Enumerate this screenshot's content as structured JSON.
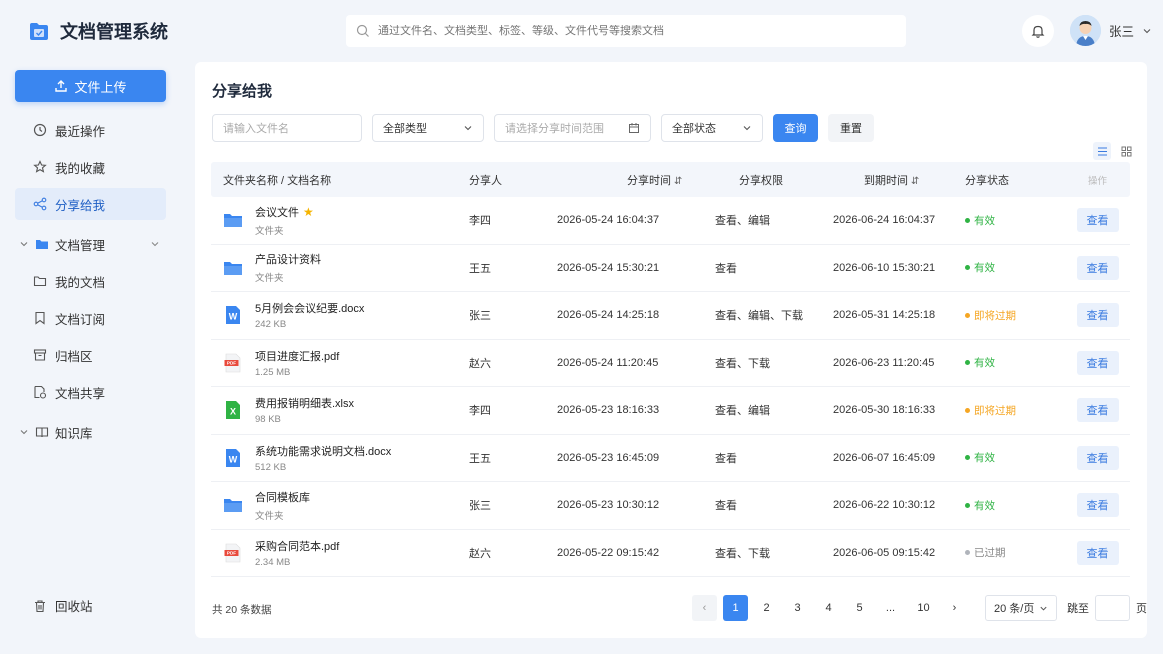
{
  "app": {
    "title": "文档管理系统"
  },
  "sidebar": {
    "upload_label": "文件上传",
    "items": [
      {
        "label": "最近操作",
        "icon": "clock-icon"
      },
      {
        "label": "我的收藏",
        "icon": "star-icon"
      },
      {
        "label": "分享给我",
        "icon": "share-icon",
        "active": true
      }
    ],
    "group_doc": {
      "label": "文档管理",
      "icon": "folder-icon"
    },
    "doc_items": [
      {
        "label": "我的文档",
        "icon": "folder-outline-icon"
      },
      {
        "label": "文档订阅",
        "icon": "bookmark-icon"
      },
      {
        "label": "归档区",
        "icon": "archive-icon"
      },
      {
        "label": "文档共享",
        "icon": "share-doc-icon"
      }
    ],
    "group_kb": {
      "label": "知识库",
      "icon": "book-icon"
    },
    "recycle_label": "回收站"
  },
  "header": {
    "search_placeholder": "通过文件名、文档类型、标签、等级、文件代号等搜索文档",
    "username": "张三"
  },
  "main": {
    "title": "分享给我",
    "filters": {
      "name_placeholder": "请输入文件名",
      "type_value": "全部类型",
      "date_placeholder": "请选择分享时间范围",
      "status_value": "全部状态",
      "query_label": "查询",
      "reset_label": "重置"
    },
    "columns": [
      "文件夹名称 / 文档名称",
      "分享人",
      "分享时间",
      "分享权限",
      "到期时间",
      "分享状态",
      "操作"
    ],
    "rows": [
      {
        "name": "会议文件",
        "meta": "文件夹",
        "type": "folder",
        "starred": true,
        "sharer": "李四",
        "share_time": "2026-05-24 16:04:37",
        "permission": "查看、编辑",
        "expire": "2026-06-24 16:04:37",
        "status": "有效",
        "status_kind": "valid",
        "action": "查看"
      },
      {
        "name": "产品设计资料",
        "meta": "文件夹",
        "type": "folder",
        "starred": false,
        "sharer": "王五",
        "share_time": "2026-05-24 15:30:21",
        "permission": "查看",
        "expire": "2026-06-10 15:30:21",
        "status": "有效",
        "status_kind": "valid",
        "action": "查看"
      },
      {
        "name": "5月例会会议纪要.docx",
        "meta": "242 KB",
        "type": "word",
        "starred": false,
        "sharer": "张三",
        "share_time": "2026-05-24 14:25:18",
        "permission": "查看、编辑、下载",
        "expire": "2026-05-31 14:25:18",
        "status": "即将过期",
        "status_kind": "expiring",
        "action": "查看"
      },
      {
        "name": "项目进度汇报.pdf",
        "meta": "1.25 MB",
        "type": "pdf",
        "starred": false,
        "sharer": "赵六",
        "share_time": "2026-05-24 11:20:45",
        "permission": "查看、下载",
        "expire": "2026-06-23 11:20:45",
        "status": "有效",
        "status_kind": "valid",
        "action": "查看"
      },
      {
        "name": "费用报销明细表.xlsx",
        "meta": "98 KB",
        "type": "excel",
        "starred": false,
        "sharer": "李四",
        "share_time": "2026-05-23 18:16:33",
        "permission": "查看、编辑",
        "expire": "2026-05-30 18:16:33",
        "status": "即将过期",
        "status_kind": "expiring",
        "action": "查看"
      },
      {
        "name": "系统功能需求说明文档.docx",
        "meta": "512 KB",
        "type": "word",
        "starred": false,
        "sharer": "王五",
        "share_time": "2026-05-23 16:45:09",
        "permission": "查看",
        "expire": "2026-06-07 16:45:09",
        "status": "有效",
        "status_kind": "valid",
        "action": "查看"
      },
      {
        "name": "合同模板库",
        "meta": "文件夹",
        "type": "folder",
        "starred": false,
        "sharer": "张三",
        "share_time": "2026-05-23 10:30:12",
        "permission": "查看",
        "expire": "2026-06-22 10:30:12",
        "status": "有效",
        "status_kind": "valid",
        "action": "查看"
      },
      {
        "name": "采购合同范本.pdf",
        "meta": "2.34 MB",
        "type": "pdf",
        "starred": false,
        "sharer": "赵六",
        "share_time": "2026-05-22 09:15:42",
        "permission": "查看、下载",
        "expire": "2026-06-05 09:15:42",
        "status": "已过期",
        "status_kind": "expired",
        "action": "查看"
      }
    ],
    "status_colors": {
      "valid": "#2fb344",
      "expiring": "#f5a623",
      "expired": "#b0b4bb"
    },
    "total_text": "共 20 条数据",
    "pages": [
      "1",
      "2",
      "3",
      "4",
      "5",
      "...",
      "10"
    ],
    "current_page": "1",
    "per_page": "20 条/页",
    "jump_prefix": "跳至",
    "jump_suffix": "页"
  },
  "colors": {
    "accent": "#3a86f0",
    "active_bg": "#e3ecfa"
  }
}
